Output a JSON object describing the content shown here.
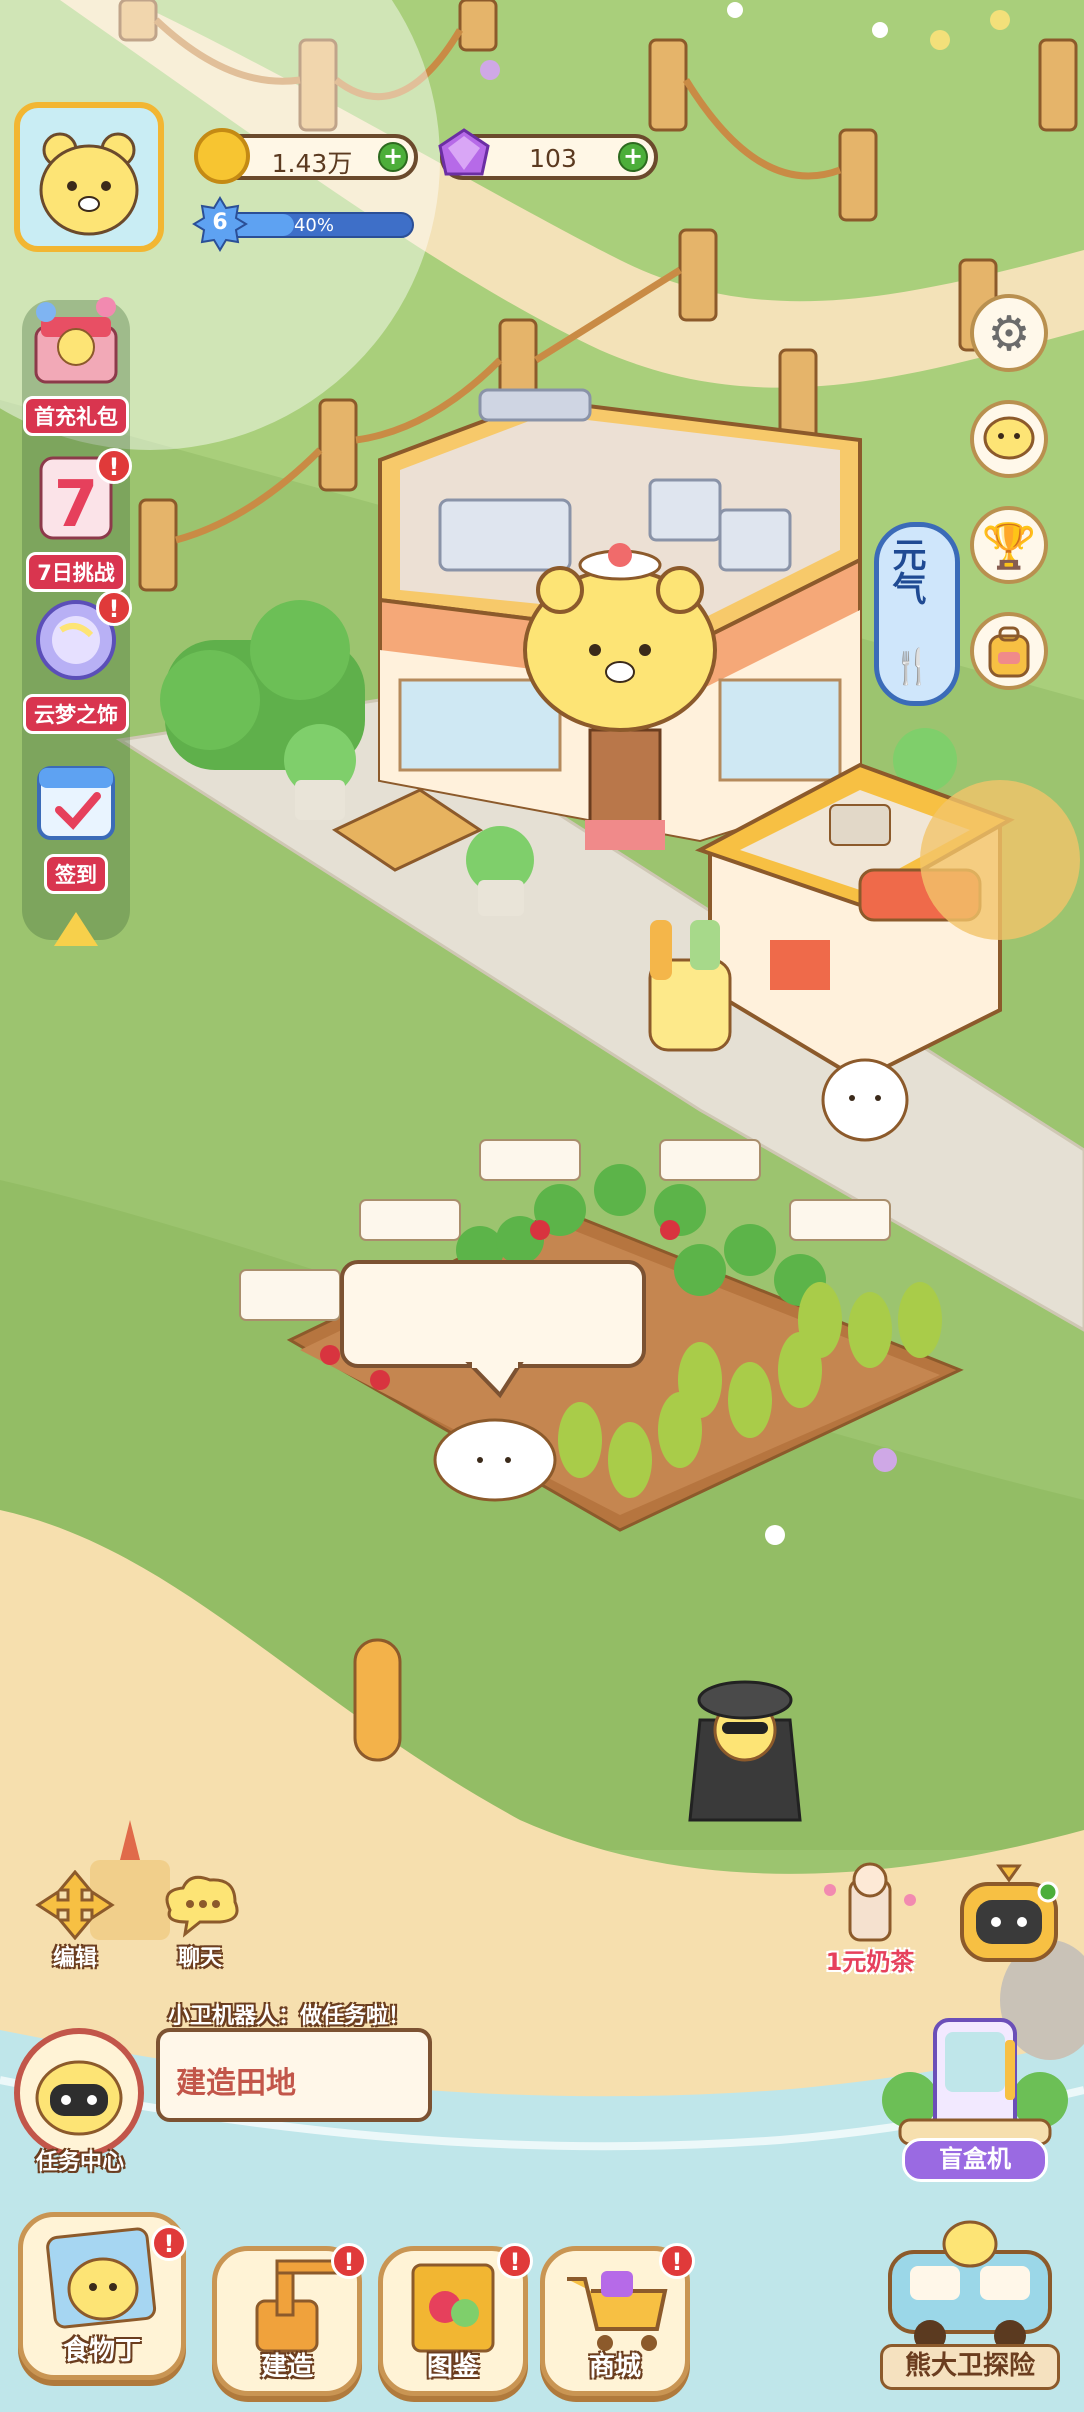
{
  "hud": {
    "coins": "1.43万",
    "gems": "103",
    "level": "6",
    "xp_percent_text": "40%",
    "xp_fraction": 0.4
  },
  "side_menu": [
    {
      "label": "首充礼包"
    },
    {
      "label": "7日挑战"
    },
    {
      "label": "云梦之饰"
    },
    {
      "label": "签到"
    }
  ],
  "right_menu": {
    "settings": "gear-icon",
    "chat": "chat-bubble-icon",
    "trophy": "trophy-icon",
    "bag": "backpack-icon"
  },
  "sign": {
    "vertical_text": "元气"
  },
  "bottom_left": {
    "edit": "编辑",
    "chat": "聊天"
  },
  "task": {
    "hint": "小卫机器人：做任务啦！",
    "current": "建造田地",
    "center_label": "任务中心"
  },
  "right_shortcuts": {
    "milk_tea": "1元奶茶",
    "blind_box": "盲盒机",
    "explore": "熊大卫探险"
  },
  "bottom_nav": [
    {
      "label": "食物丁",
      "badge": "!"
    },
    {
      "label": "建造",
      "badge": "!"
    },
    {
      "label": "图鉴",
      "badge": "!"
    },
    {
      "label": "商城",
      "badge": "!"
    }
  ],
  "colors": {
    "grass": "#9cc46f",
    "path": "#f3e2b8",
    "sand": "#f6dfae",
    "water": "#bfe6ea",
    "accent_red": "#e03a3a"
  }
}
